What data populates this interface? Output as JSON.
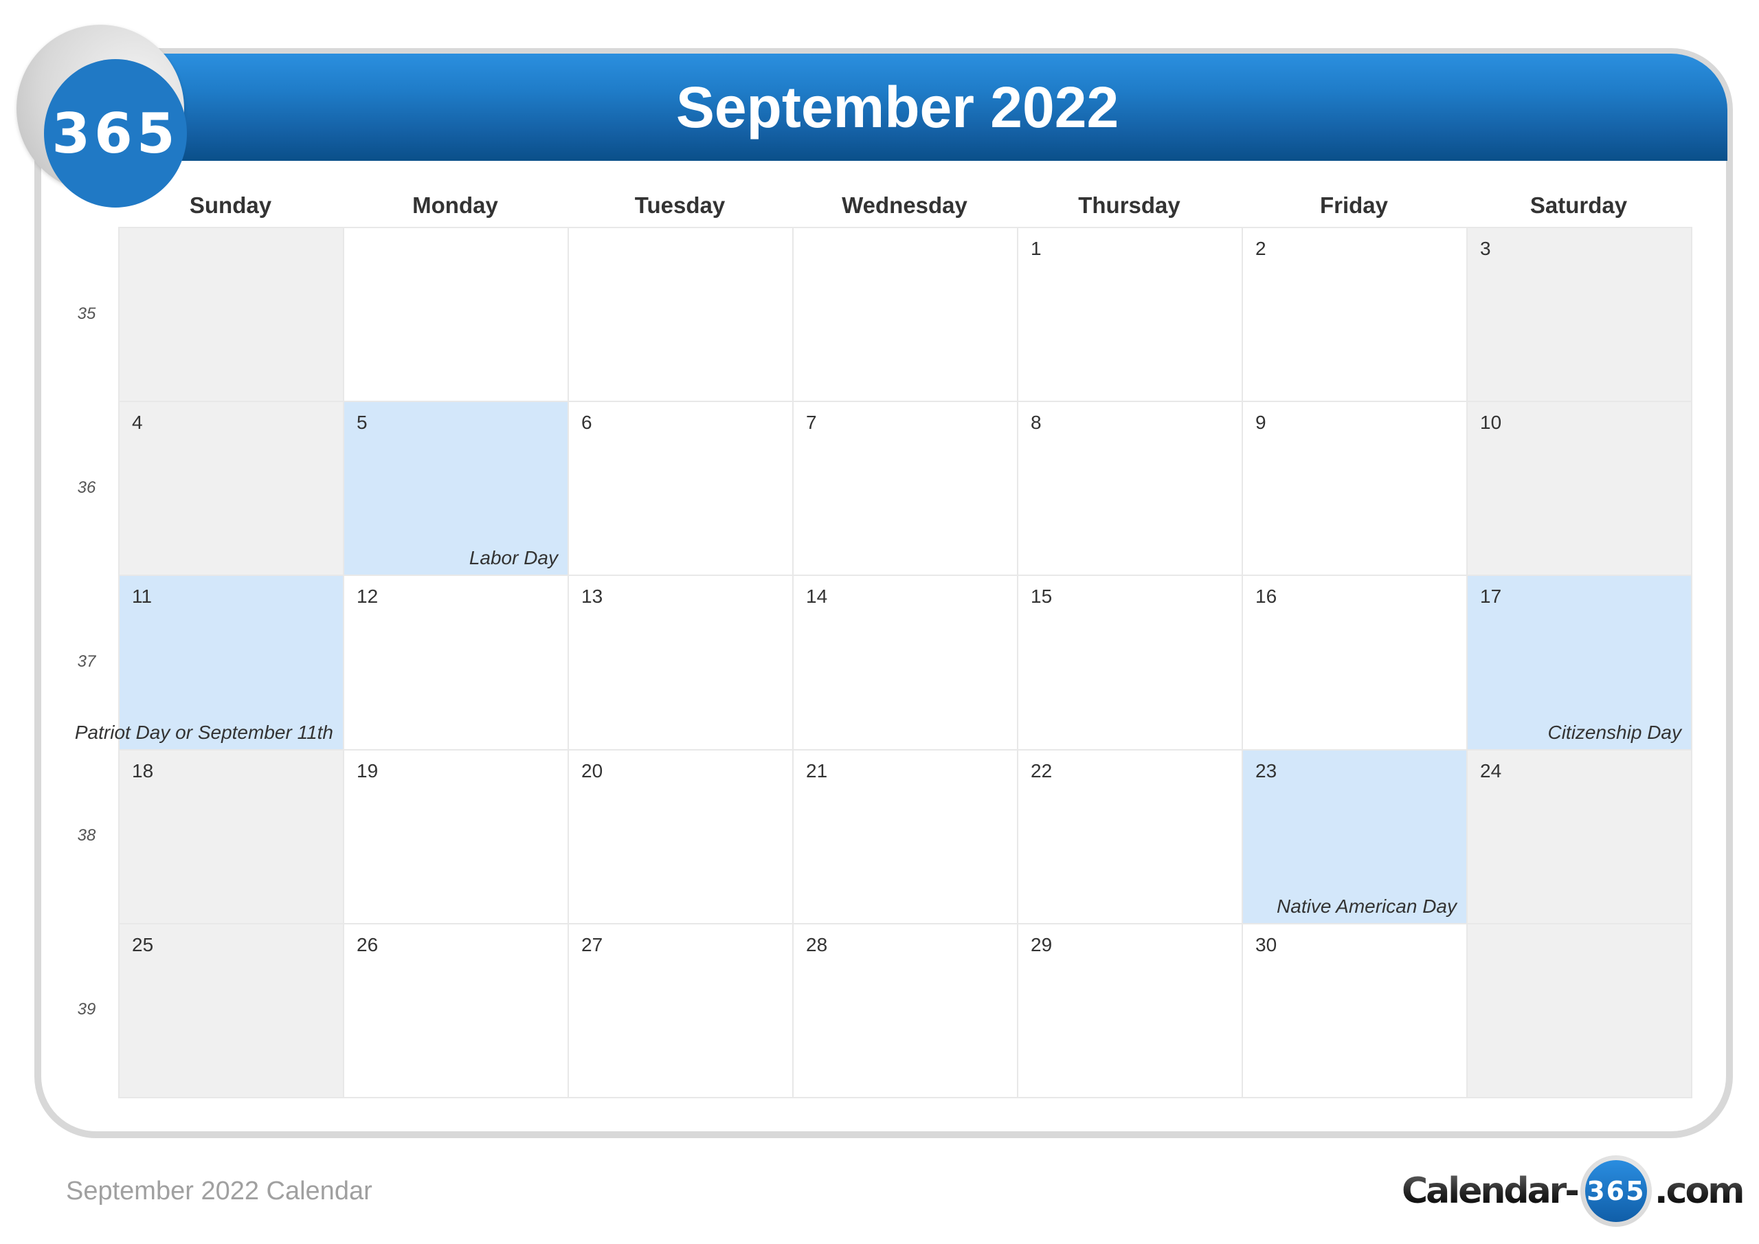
{
  "header": {
    "logo_text": "365",
    "title": "September 2022"
  },
  "weekdays": [
    "Sunday",
    "Monday",
    "Tuesday",
    "Wednesday",
    "Thursday",
    "Friday",
    "Saturday"
  ],
  "week_numbers": [
    "35",
    "36",
    "37",
    "38",
    "39"
  ],
  "weeks": [
    [
      {
        "day": "",
        "type": "weekend"
      },
      {
        "day": "",
        "type": "normal"
      },
      {
        "day": "",
        "type": "normal"
      },
      {
        "day": "",
        "type": "normal"
      },
      {
        "day": "1",
        "type": "normal"
      },
      {
        "day": "2",
        "type": "normal"
      },
      {
        "day": "3",
        "type": "weekend"
      }
    ],
    [
      {
        "day": "4",
        "type": "weekend"
      },
      {
        "day": "5",
        "type": "holiday",
        "holiday": "Labor Day"
      },
      {
        "day": "6",
        "type": "normal"
      },
      {
        "day": "7",
        "type": "normal"
      },
      {
        "day": "8",
        "type": "normal"
      },
      {
        "day": "9",
        "type": "normal"
      },
      {
        "day": "10",
        "type": "weekend"
      }
    ],
    [
      {
        "day": "11",
        "type": "holiday",
        "holiday": "Patriot Day or September 11th"
      },
      {
        "day": "12",
        "type": "normal"
      },
      {
        "day": "13",
        "type": "normal"
      },
      {
        "day": "14",
        "type": "normal"
      },
      {
        "day": "15",
        "type": "normal"
      },
      {
        "day": "16",
        "type": "normal"
      },
      {
        "day": "17",
        "type": "holiday",
        "holiday": "Citizenship Day"
      }
    ],
    [
      {
        "day": "18",
        "type": "weekend"
      },
      {
        "day": "19",
        "type": "normal"
      },
      {
        "day": "20",
        "type": "normal"
      },
      {
        "day": "21",
        "type": "normal"
      },
      {
        "day": "22",
        "type": "normal"
      },
      {
        "day": "23",
        "type": "holiday",
        "holiday": "Native American Day"
      },
      {
        "day": "24",
        "type": "weekend"
      }
    ],
    [
      {
        "day": "25",
        "type": "weekend"
      },
      {
        "day": "26",
        "type": "normal"
      },
      {
        "day": "27",
        "type": "normal"
      },
      {
        "day": "28",
        "type": "normal"
      },
      {
        "day": "29",
        "type": "normal"
      },
      {
        "day": "30",
        "type": "normal"
      },
      {
        "day": "",
        "type": "weekend"
      }
    ]
  ],
  "footer": {
    "caption": "September 2022 Calendar",
    "brand_prefix": "Calendar-",
    "brand_number": "365",
    "brand_suffix": ".com"
  },
  "colors": {
    "header_blue": "#1f7cc8",
    "holiday_fill": "#d3e7fa",
    "weekend_fill": "#f0f0f0"
  }
}
